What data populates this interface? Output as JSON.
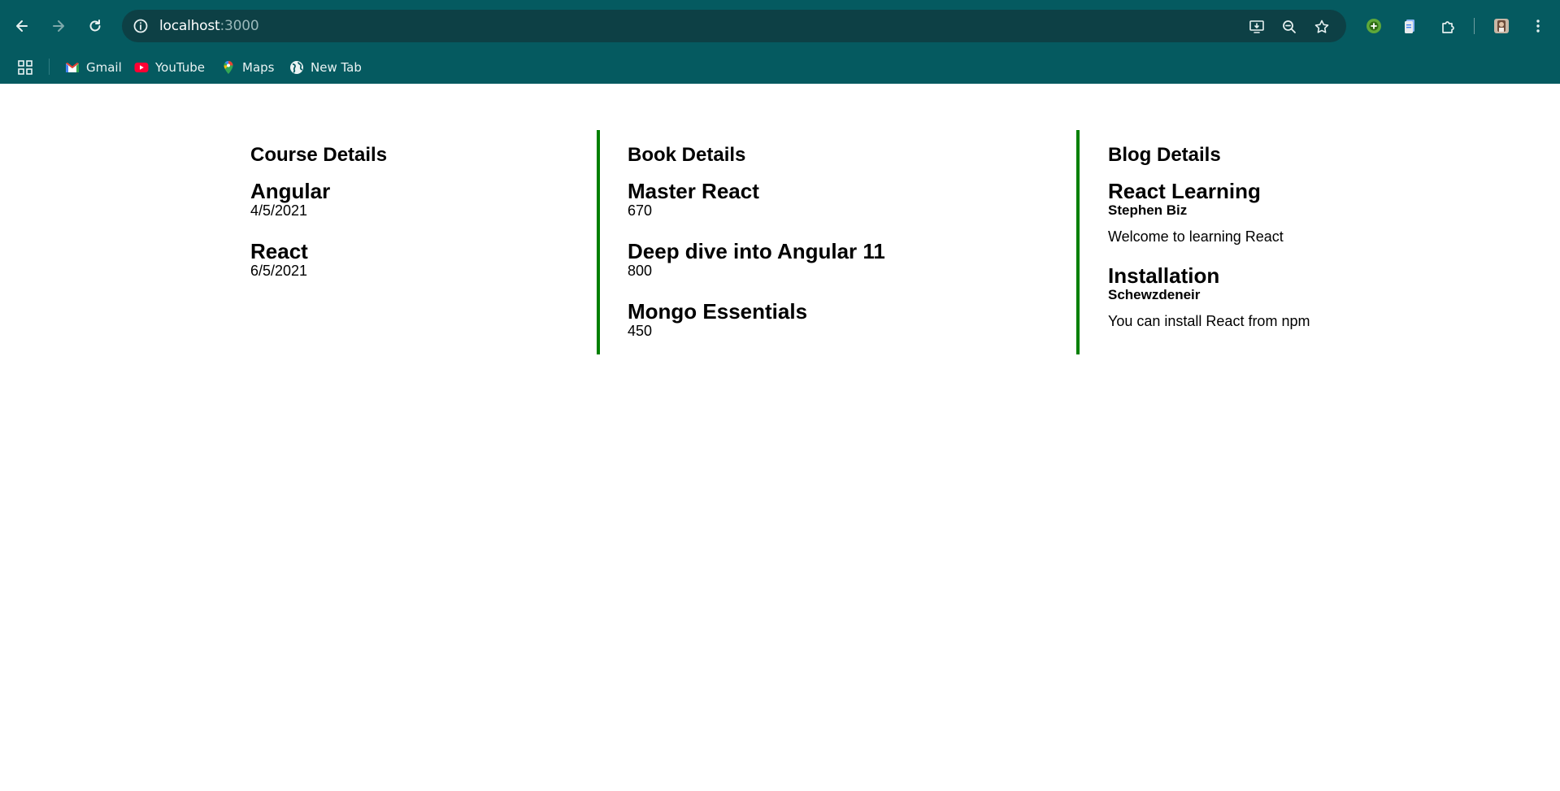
{
  "browser": {
    "url_host": "localhost",
    "url_port": ":3000",
    "bookmarks": [
      {
        "label": "Gmail",
        "icon": "gmail-icon"
      },
      {
        "label": "YouTube",
        "icon": "youtube-icon"
      },
      {
        "label": "Maps",
        "icon": "maps-icon"
      },
      {
        "label": "New Tab",
        "icon": "globe-icon"
      }
    ],
    "colors": {
      "frame": "#055a60",
      "omnibox": "#0d4045"
    }
  },
  "course": {
    "heading": "Course Details",
    "items": [
      {
        "name": "Angular",
        "date": "4/5/2021"
      },
      {
        "name": "React",
        "date": "6/5/2021"
      }
    ]
  },
  "book": {
    "heading": "Book Details",
    "items": [
      {
        "name": "Master React",
        "price": "670"
      },
      {
        "name": "Deep dive into Angular 11",
        "price": "800"
      },
      {
        "name": "Mongo Essentials",
        "price": "450"
      }
    ]
  },
  "blog": {
    "heading": "Blog Details",
    "items": [
      {
        "title": "React Learning",
        "author": "Stephen Biz",
        "text": "Welcome to learning React"
      },
      {
        "title": "Installation",
        "author": "Schewzdeneir",
        "text": "You can install React from npm"
      }
    ]
  },
  "accent_color": "#008000"
}
